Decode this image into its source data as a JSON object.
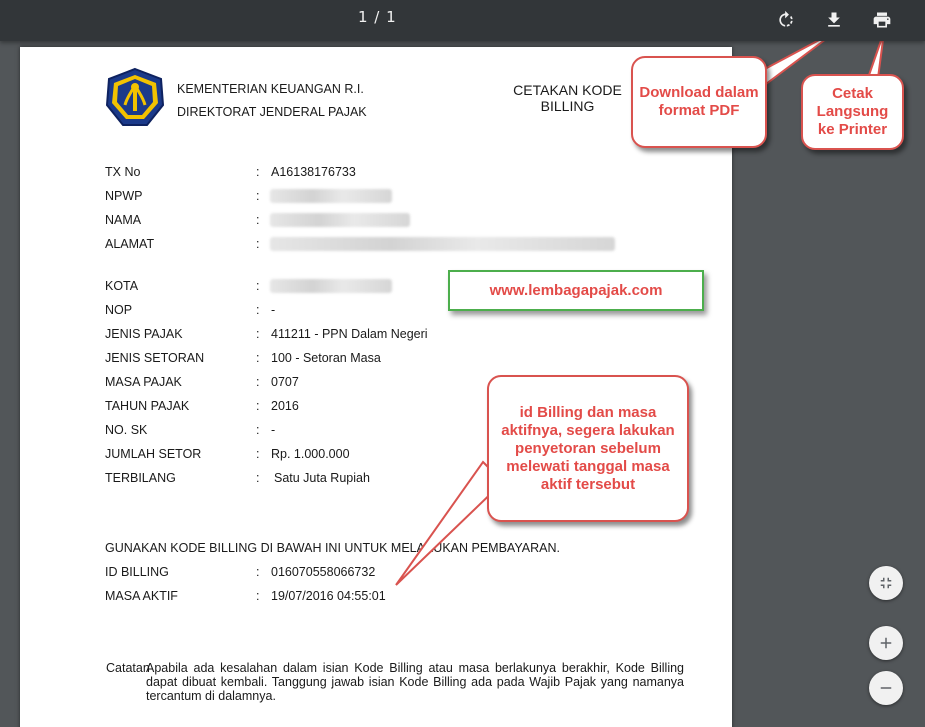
{
  "toolbar": {
    "page_indicator": "1 / 1",
    "icons": [
      "rotate-icon",
      "download-icon",
      "print-icon"
    ]
  },
  "document": {
    "ministry": "KEMENTERIAN KEUANGAN R.I.",
    "directorate": "DIREKTORAT JENDERAL PAJAK",
    "title_line1": "CETAKAN KODE",
    "title_line2": "BILLING",
    "fields": [
      {
        "label": "TX No",
        "value": "A16138176733"
      },
      {
        "label": "NPWP",
        "value": ""
      },
      {
        "label": "NAMA",
        "value": ""
      },
      {
        "label": "ALAMAT",
        "value": ""
      },
      {
        "label": "KOTA",
        "value": ""
      },
      {
        "label": "NOP",
        "value": "-"
      },
      {
        "label": "JENIS PAJAK",
        "value": "411211 - PPN Dalam Negeri"
      },
      {
        "label": "JENIS SETORAN",
        "value": "100 - Setoran Masa"
      },
      {
        "label": "MASA PAJAK",
        "value": "0707"
      },
      {
        "label": "TAHUN PAJAK",
        "value": "2016"
      },
      {
        "label": "NO. SK",
        "value": "-"
      },
      {
        "label": "JUMLAH SETOR",
        "value": "Rp. 1.000.000"
      },
      {
        "label": "TERBILANG",
        "value": "Satu Juta  Rupiah"
      }
    ],
    "separator": ":",
    "instruction": "GUNAKAN KODE BILLING DI BAWAH INI UNTUK MELAKUKAN PEMBAYARAN.",
    "billing": [
      {
        "label": "ID BILLING",
        "value": "016070558066732"
      },
      {
        "label": "MASA AKTIF",
        "value": "19/07/2016 04:55:01"
      }
    ],
    "catatan_label": "Catatan",
    "catatan_text": "Apabila ada kesalahan dalam isian Kode Billing atau masa berlakunya berakhir, Kode Billing dapat dibuat kembali. Tanggung jawab isian Kode Billing ada pada Wajib Pajak yang namanya tercantum di dalamnya."
  },
  "annotations": {
    "download_note": "Download dalam format PDF",
    "print_note": "Cetak Langsung ke Printer",
    "website": "www.lembagapajak.com",
    "billing_note": "id Billing dan masa aktifnya, segera lakukan penyetoran sebelum melewati tanggal masa aktif tersebut",
    "accent_color": "#e34b48",
    "border_color": "#d9534f",
    "website_border_color": "#4cae4c"
  },
  "zoom_controls": [
    "fit-page-icon",
    "zoom-in-icon",
    "zoom-out-icon"
  ]
}
